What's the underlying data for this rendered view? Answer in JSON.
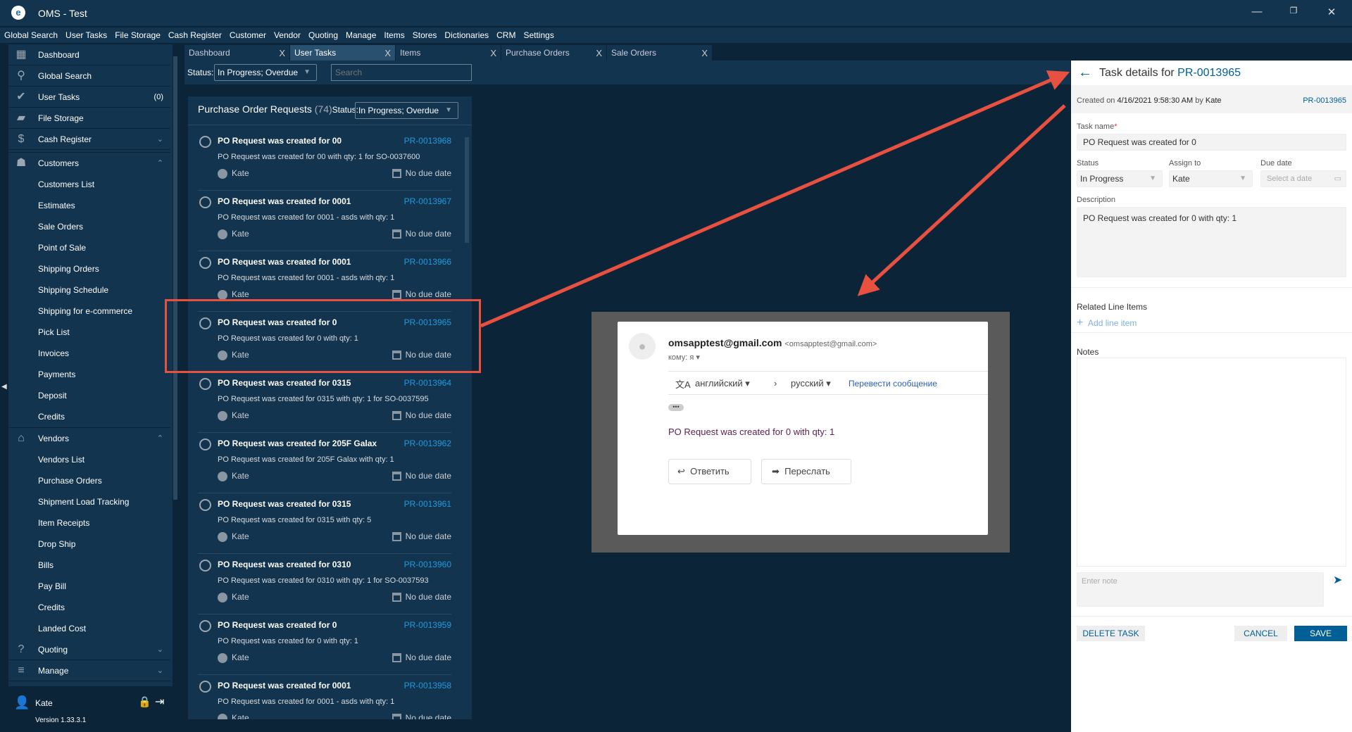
{
  "app": {
    "title": "OMS - Test",
    "logo": "oms-logo"
  },
  "menu": [
    "Global Search",
    "User Tasks",
    "File Storage",
    "Cash Register",
    "Customer",
    "Vendor",
    "Quoting",
    "Manage",
    "Items",
    "Stores",
    "Dictionaries",
    "CRM",
    "Settings"
  ],
  "sidebar": {
    "items": [
      {
        "label": "Dashboard",
        "icon": "dashboard-icon",
        "glyph": "▦",
        "type": "top"
      },
      {
        "label": "Global Search",
        "icon": "search-icon",
        "glyph": "⚲",
        "type": "top"
      },
      {
        "label": "User Tasks",
        "icon": "check-circle-icon",
        "glyph": "✔",
        "type": "top",
        "badge": "(0)"
      },
      {
        "label": "File Storage",
        "icon": "folder-icon",
        "glyph": "▰",
        "type": "top"
      },
      {
        "label": "Cash Register",
        "icon": "dollar-icon",
        "glyph": "$",
        "type": "top",
        "chev": "⌄"
      },
      {
        "label": "Customers",
        "icon": "contact-icon",
        "glyph": "☗",
        "type": "group",
        "chev": "⌃"
      },
      {
        "label": "Customers List",
        "type": "sub"
      },
      {
        "label": "Estimates",
        "type": "sub"
      },
      {
        "label": "Sale Orders",
        "type": "sub"
      },
      {
        "label": "Point of Sale",
        "type": "sub"
      },
      {
        "label": "Shipping Orders",
        "type": "sub"
      },
      {
        "label": "Shipping Schedule",
        "type": "sub"
      },
      {
        "label": "Shipping for e-commerce",
        "type": "sub"
      },
      {
        "label": "Pick List",
        "type": "sub"
      },
      {
        "label": "Invoices",
        "type": "sub"
      },
      {
        "label": "Payments",
        "type": "sub"
      },
      {
        "label": "Deposit",
        "type": "sub"
      },
      {
        "label": "Credits",
        "type": "sub"
      },
      {
        "label": "Vendors",
        "icon": "store-icon",
        "glyph": "⌂",
        "type": "group",
        "chev": "⌃"
      },
      {
        "label": "Vendors List",
        "type": "sub"
      },
      {
        "label": "Purchase Orders",
        "type": "sub"
      },
      {
        "label": "Shipment Load Tracking",
        "type": "sub"
      },
      {
        "label": "Item Receipts",
        "type": "sub"
      },
      {
        "label": "Drop Ship",
        "type": "sub"
      },
      {
        "label": "Bills",
        "type": "sub"
      },
      {
        "label": "Pay Bill",
        "type": "sub"
      },
      {
        "label": "Credits",
        "type": "sub"
      },
      {
        "label": "Landed Cost",
        "type": "sub"
      },
      {
        "label": "Quoting",
        "icon": "clipboard-question-icon",
        "glyph": "?",
        "type": "top",
        "chev": "⌄"
      },
      {
        "label": "Manage",
        "icon": "clipboard-icon",
        "glyph": "≡",
        "type": "top",
        "chev": "⌄"
      }
    ],
    "user": "Kate",
    "version": "Version 1.33.3.1"
  },
  "tabs": [
    {
      "label": "Dashboard",
      "active": false
    },
    {
      "label": "User Tasks",
      "active": true
    },
    {
      "label": "Items",
      "active": false
    },
    {
      "label": "Purchase Orders",
      "active": false
    },
    {
      "label": "Sale Orders",
      "active": false
    }
  ],
  "filter": {
    "status_label": "Status:",
    "status_value": "In Progress; Overdue",
    "search_placeholder": "Search"
  },
  "list": {
    "title": "Purchase Order Requests",
    "count": "(74)",
    "status_label": "Status:",
    "status_value": "In Progress; Overdue",
    "items": [
      {
        "title": "PO Request was created for 00",
        "pr": "PR-0013968",
        "desc": "PO Request was created for 00 with qty: 1 for SO-0037600",
        "user": "Kate",
        "due": "No due date"
      },
      {
        "title": "PO Request was created for 0001",
        "pr": "PR-0013967",
        "desc": "PO Request was created for 0001 - asds with qty: 1",
        "user": "Kate",
        "due": "No due date"
      },
      {
        "title": "PO Request was created for 0001",
        "pr": "PR-0013966",
        "desc": "PO Request was created for 0001 - asds with qty: 1",
        "user": "Kate",
        "due": "No due date"
      },
      {
        "title": "PO Request was created for 0",
        "pr": "PR-0013965",
        "desc": "PO Request was created for 0 with qty: 1",
        "user": "Kate",
        "due": "No due date"
      },
      {
        "title": "PO Request was created for 0315",
        "pr": "PR-0013964",
        "desc": "PO Request was created for 0315 with qty: 1 for SO-0037595",
        "user": "Kate",
        "due": "No due date"
      },
      {
        "title": "PO Request was created for 205F Galax",
        "pr": "PR-0013962",
        "desc": "PO Request was created for 205F Galax with qty: 1",
        "user": "Kate",
        "due": "No due date"
      },
      {
        "title": "PO Request was created for 0315",
        "pr": "PR-0013961",
        "desc": "PO Request was created for 0315 with qty: 5",
        "user": "Kate",
        "due": "No due date"
      },
      {
        "title": "PO Request was created for 0310",
        "pr": "PR-0013960",
        "desc": "PO Request was created for 0310 with qty: 1 for SO-0037593",
        "user": "Kate",
        "due": "No due date"
      },
      {
        "title": "PO Request was created for 0",
        "pr": "PR-0013959",
        "desc": "PO Request was created for 0 with qty: 1",
        "user": "Kate",
        "due": "No due date"
      },
      {
        "title": "PO Request was created for 0001",
        "pr": "PR-0013958",
        "desc": "PO Request was created for 0001 - asds with qty: 1",
        "user": "Kate",
        "due": "No due date"
      }
    ]
  },
  "email": {
    "sender": "omsapptest@gmail.com",
    "sender_addr": "<omsapptest@gmail.com>",
    "to": "кому: я",
    "from_lang": "английский",
    "to_lang": "русский",
    "translate": "Перевести сообщение",
    "body": "PO Request was created for 0 with qty: 1",
    "reply": "Ответить",
    "forward": "Переслать"
  },
  "detail": {
    "title_prefix": "Task details for",
    "pr": "PR-0013965",
    "created_prefix": "Created on",
    "created_date": "4/16/2021 9:58:30 AM",
    "created_by_prefix": "by",
    "created_by": "Kate",
    "task_name_label": "Task name",
    "task_name": "PO Request was created for 0",
    "status_label": "Status",
    "status": "In Progress",
    "assign_label": "Assign to",
    "assign": "Kate",
    "due_label": "Due date",
    "due_placeholder": "Select a date",
    "desc_label": "Description",
    "desc": "PO Request was created for 0 with qty: 1",
    "related_label": "Related Line Items",
    "add_line": "Add line item",
    "notes_label": "Notes",
    "note_placeholder": "Enter note",
    "delete": "DELETE TASK",
    "cancel": "CANCEL",
    "save": "SAVE"
  },
  "colors": {
    "accent": "#1e9be0",
    "primary_btn": "#005f96",
    "highlight": "#e8503f",
    "panel": "#12344e",
    "bg": "#0b2438"
  }
}
